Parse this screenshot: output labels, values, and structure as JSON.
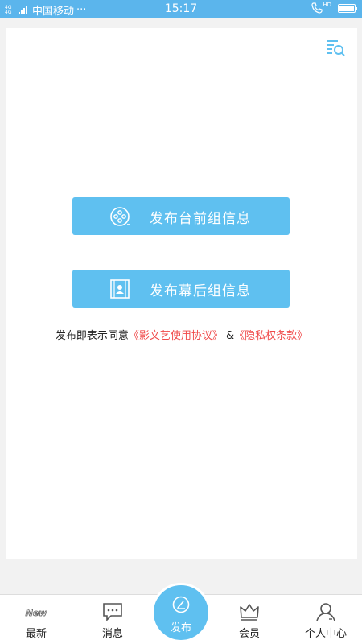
{
  "status_bar": {
    "network": "4G 4G",
    "carrier": "中国移动",
    "more": "···",
    "time": "15:17",
    "hd": "HD",
    "icons": [
      "signal-icon",
      "call-hd-icon",
      "battery-icon"
    ]
  },
  "main": {
    "filter_icon": "list-search-icon",
    "buttons": [
      {
        "label": "发布台前组信息",
        "icon": "film-reel-icon"
      },
      {
        "label": "发布幕后组信息",
        "icon": "portrait-frame-icon"
      }
    ],
    "agreement": {
      "prefix": "发布即表示同意",
      "terms_link": "《影文艺使用协议》",
      "joiner": "&",
      "privacy_link": "《隐私权条款》"
    }
  },
  "tab_bar": {
    "tabs": [
      {
        "label": "最新",
        "icon": "new-badge-icon"
      },
      {
        "label": "消息",
        "icon": "chat-bubble-icon"
      },
      {
        "label": "发布",
        "icon": "pencil-circle-icon"
      },
      {
        "label": "会员",
        "icon": "crown-icon"
      },
      {
        "label": "个人中心",
        "icon": "person-icon"
      }
    ]
  },
  "colors": {
    "accent": "#5fc0f0",
    "status_bar": "#5bb5ec",
    "link": "#f04a4a",
    "background": "#f2f2f2"
  }
}
